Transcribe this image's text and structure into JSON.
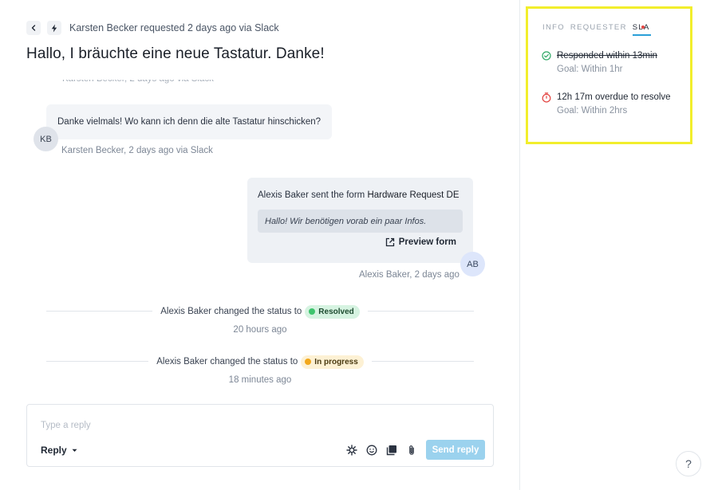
{
  "header": {
    "requester_line": "Karsten Becker requested 2 days ago via Slack",
    "title": "Hallo, I bräuchte eine neue Tastatur. Danke!"
  },
  "conversation": {
    "ghost_meta": "Karsten Becker, 2 days ago via Slack",
    "message": {
      "text": "Danke vielmals! Wo kann ich denn die alte Tastatur hinschicken?",
      "avatar": "KB",
      "meta": "Karsten Becker, 2 days ago via Slack"
    },
    "form": {
      "sender": "Alexis Baker",
      "action": "sent the form",
      "form_name": "Hardware Request DE",
      "quote": "Hallo! Wir benötigen vorab ein paar Infos.",
      "preview_label": "Preview form",
      "avatar": "AB",
      "meta": "Alexis Baker, 2 days ago"
    },
    "events": [
      {
        "text": "Alexis Baker changed the status to",
        "status": "Resolved",
        "status_color": "#3ec46d",
        "time": "20 hours ago"
      },
      {
        "text": "Alexis Baker changed the status to",
        "status": "In progress",
        "status_color": "#f2a81b",
        "time": "18 minutes ago"
      }
    ]
  },
  "composer": {
    "placeholder": "Type a reply",
    "value": "",
    "mode": "Reply",
    "send_label": "Send reply",
    "tools": [
      "snippet-icon",
      "emoji-icon",
      "knowledge-icon",
      "attachment-icon"
    ]
  },
  "sidebar": {
    "tabs": [
      {
        "label": "INFO",
        "active": false
      },
      {
        "label": "REQUESTER",
        "active": false
      },
      {
        "label": "SLA",
        "active": true
      }
    ],
    "sla": [
      {
        "title": "Responded within 13min",
        "goal": "Goal: Within 1hr",
        "state": "met",
        "color": "#2fa866"
      },
      {
        "title": "12h 17m overdue to resolve",
        "goal": "Goal: Within 2hrs",
        "state": "overdue",
        "color": "#e3423f"
      }
    ],
    "help_label": "?"
  },
  "colors": {
    "accent": "#2a9fd8",
    "send_button": "#9bd2ee",
    "highlight_border": "#f2ee2c"
  }
}
